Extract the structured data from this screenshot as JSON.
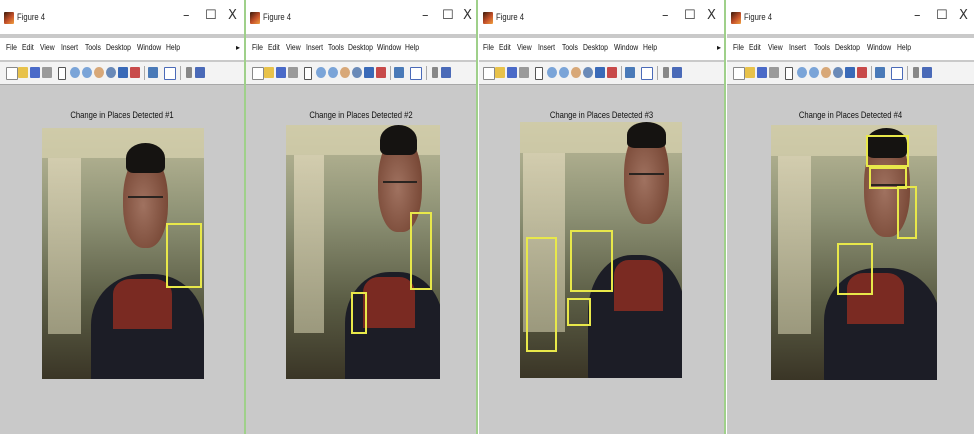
{
  "windows": [
    {
      "title": "Figure 4",
      "menu": [
        "File",
        "Edit",
        "View",
        "Insert",
        "Tools",
        "Desktop",
        "Window",
        "Help"
      ],
      "figure_title": "Change in Places Detected #1"
    },
    {
      "title": "Figure 4",
      "menu": [
        "File",
        "Edit",
        "View",
        "Insert",
        "Tools",
        "Desktop",
        "Window",
        "Help"
      ],
      "figure_title": "Change in Places Detected #2"
    },
    {
      "title": "Figure 4",
      "menu": [
        "File",
        "Edit",
        "View",
        "Insert",
        "Tools",
        "Desktop",
        "Window",
        "Help"
      ],
      "figure_title": "Change in Places Detected #3"
    },
    {
      "title": "Figure 4",
      "menu": [
        "File",
        "Edit",
        "View",
        "Insert",
        "Tools",
        "Desktop",
        "Window",
        "Help"
      ],
      "figure_title": "Change in Places Detected #4"
    }
  ],
  "window_controls": {
    "minimize": "–",
    "maximize": "☐",
    "close": "X"
  },
  "menu_more": "▸",
  "colors": {
    "detection_box": "#e8e84a",
    "window_bg": "#c9c9c9",
    "separator": "#9fd08a"
  },
  "toolbar_icons": [
    "new-figure-icon",
    "open-file-icon",
    "save-icon",
    "print-icon",
    "pointer-icon",
    "zoom-in-icon",
    "zoom-out-icon",
    "pan-icon",
    "rotate-icon",
    "data-cursor-icon",
    "brush-icon",
    "link-icon",
    "colorbar-icon",
    "legend-icon",
    "hide-plot-tools-icon",
    "show-plot-tools-icon"
  ]
}
